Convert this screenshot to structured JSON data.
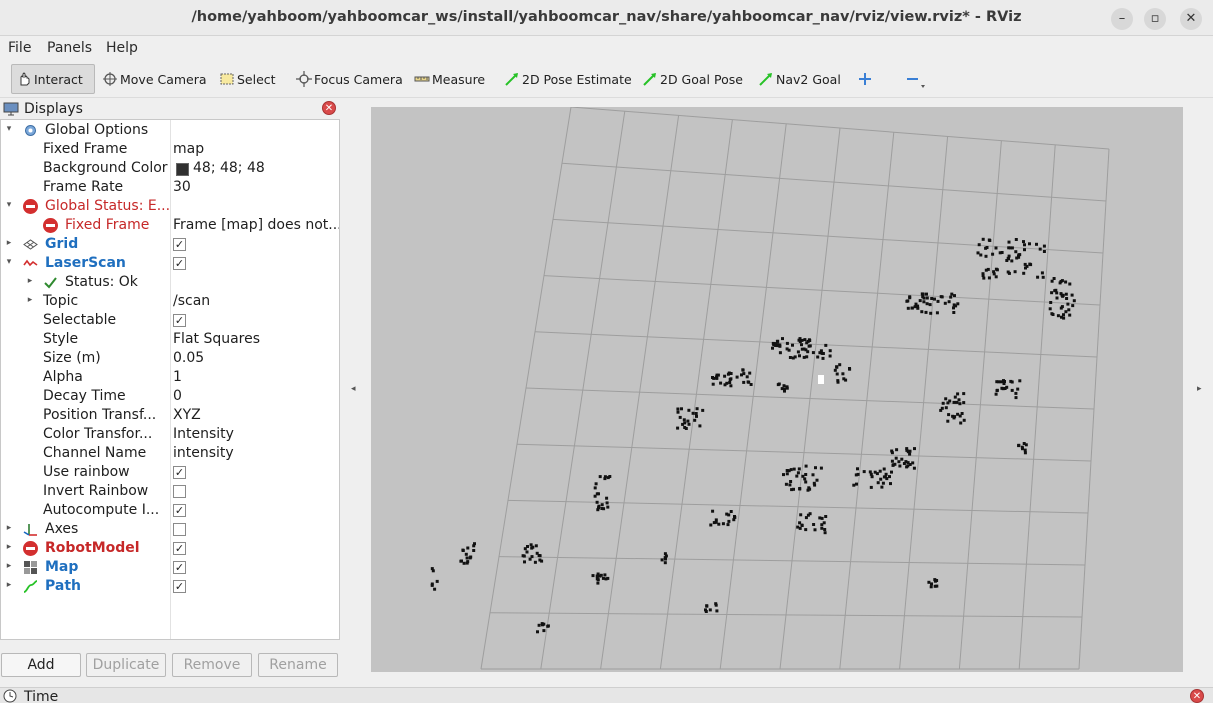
{
  "window": {
    "title": "/home/yahboom/yahboomcar_ws/install/yahboomcar_nav/share/yahboomcar_nav/rviz/view.rviz* - RViz",
    "minimize_glyph": "–",
    "maximize_glyph": "▫",
    "close_glyph": "✕"
  },
  "menu": [
    {
      "label": "File"
    },
    {
      "label": "Panels"
    },
    {
      "label": "Help"
    }
  ],
  "toolbar": [
    {
      "label": "Interact",
      "icon": "hand-icon",
      "active": true
    },
    {
      "label": "Move Camera",
      "icon": "move-camera-icon"
    },
    {
      "label": "Select",
      "icon": "select-icon"
    },
    {
      "label": "Focus Camera",
      "icon": "focus-camera-icon"
    },
    {
      "label": "Measure",
      "icon": "measure-icon"
    },
    {
      "label": "2D Pose Estimate",
      "icon": "green-arrow-icon"
    },
    {
      "label": "2D Goal Pose",
      "icon": "green-arrow-icon"
    },
    {
      "label": "Nav2 Goal",
      "icon": "green-arrow-icon"
    },
    {
      "label": "",
      "icon": "plus-icon"
    },
    {
      "label": "",
      "icon": "minus-icon"
    }
  ],
  "displays_panel": {
    "title": "Displays",
    "rows": [
      {
        "name": "Global Options",
        "value": "",
        "indent": 0,
        "arrow": "▾",
        "icon": "gear-icon"
      },
      {
        "name": "Fixed Frame",
        "value": "map",
        "indent": 1
      },
      {
        "name": "Background Color",
        "value": "48; 48; 48",
        "indent": 1,
        "swatch": "#303030"
      },
      {
        "name": "Frame Rate",
        "value": "30",
        "indent": 1
      },
      {
        "name": "Global Status: E...",
        "value": "",
        "indent": 0,
        "arrow": "▾",
        "icon": "error-icon",
        "style": "red"
      },
      {
        "name": "Fixed Frame",
        "value": "Frame [map] does not...",
        "indent": 1,
        "icon": "error-icon",
        "style": "red"
      },
      {
        "name": "Grid",
        "value": "",
        "indent": 0,
        "arrow": "▸",
        "icon": "grid-icon",
        "style": "blue",
        "check": true
      },
      {
        "name": "LaserScan",
        "value": "",
        "indent": 0,
        "arrow": "▾",
        "icon": "laserscan-icon",
        "style": "blue",
        "check": true
      },
      {
        "name": "Status: Ok",
        "value": "",
        "indent": 1,
        "arrow": "▸",
        "icon": "checkmark-icon"
      },
      {
        "name": "Topic",
        "value": "/scan",
        "indent": 1,
        "arrow": "▸"
      },
      {
        "name": "Selectable",
        "value": "",
        "indent": 1,
        "check": true
      },
      {
        "name": "Style",
        "value": "Flat Squares",
        "indent": 1
      },
      {
        "name": "Size (m)",
        "value": "0.05",
        "indent": 1
      },
      {
        "name": "Alpha",
        "value": "1",
        "indent": 1
      },
      {
        "name": "Decay Time",
        "value": "0",
        "indent": 1
      },
      {
        "name": "Position Transf...",
        "value": "XYZ",
        "indent": 1
      },
      {
        "name": "Color Transfor...",
        "value": "Intensity",
        "indent": 1
      },
      {
        "name": "Channel Name",
        "value": "intensity",
        "indent": 1
      },
      {
        "name": "Use rainbow",
        "value": "",
        "indent": 1,
        "check": true
      },
      {
        "name": "Invert Rainbow",
        "value": "",
        "indent": 1,
        "check": false
      },
      {
        "name": "Autocompute I...",
        "value": "",
        "indent": 1,
        "check": true
      },
      {
        "name": "Axes",
        "value": "",
        "indent": 0,
        "arrow": "▸",
        "icon": "axes-icon",
        "check": false
      },
      {
        "name": "RobotModel",
        "value": "",
        "indent": 0,
        "arrow": "▸",
        "icon": "error-icon",
        "style": "redb",
        "check": true
      },
      {
        "name": "Map",
        "value": "",
        "indent": 0,
        "arrow": "▸",
        "icon": "map-icon",
        "style": "blue",
        "check": true
      },
      {
        "name": "Path",
        "value": "",
        "indent": 0,
        "arrow": "▸",
        "icon": "path-icon",
        "style": "blue",
        "check": true
      }
    ],
    "buttons": {
      "add": "Add",
      "duplicate": "Duplicate",
      "remove": "Remove",
      "rename": "Rename"
    }
  },
  "viewport": {
    "background_color": "#c3c3c3",
    "grid_color": "#9e9e9e",
    "scan_color": "#111111",
    "left_arrow": "◂",
    "right_arrow": "▸"
  },
  "time_panel": {
    "title": "Time"
  }
}
